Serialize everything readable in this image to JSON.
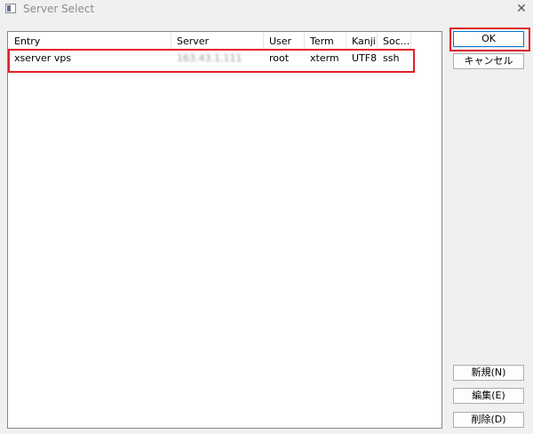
{
  "window": {
    "title": "Server Select",
    "close_glyph": "✕"
  },
  "list": {
    "columns": [
      "Entry",
      "Server",
      "User",
      "Term",
      "Kanji",
      "Soc..."
    ],
    "rows": [
      {
        "entry": "xserver vps",
        "server": "163.43.1.111",
        "user": "root",
        "term": "xterm",
        "kanji": "UTF8",
        "socket": "ssh"
      }
    ]
  },
  "buttons": {
    "ok": "OK",
    "cancel": "キャンセル",
    "new": "新規(N)",
    "edit": "編集(E)",
    "delete": "削除(D)"
  },
  "colors": {
    "highlight": "#e0202a",
    "focus_border": "#0078d7"
  }
}
